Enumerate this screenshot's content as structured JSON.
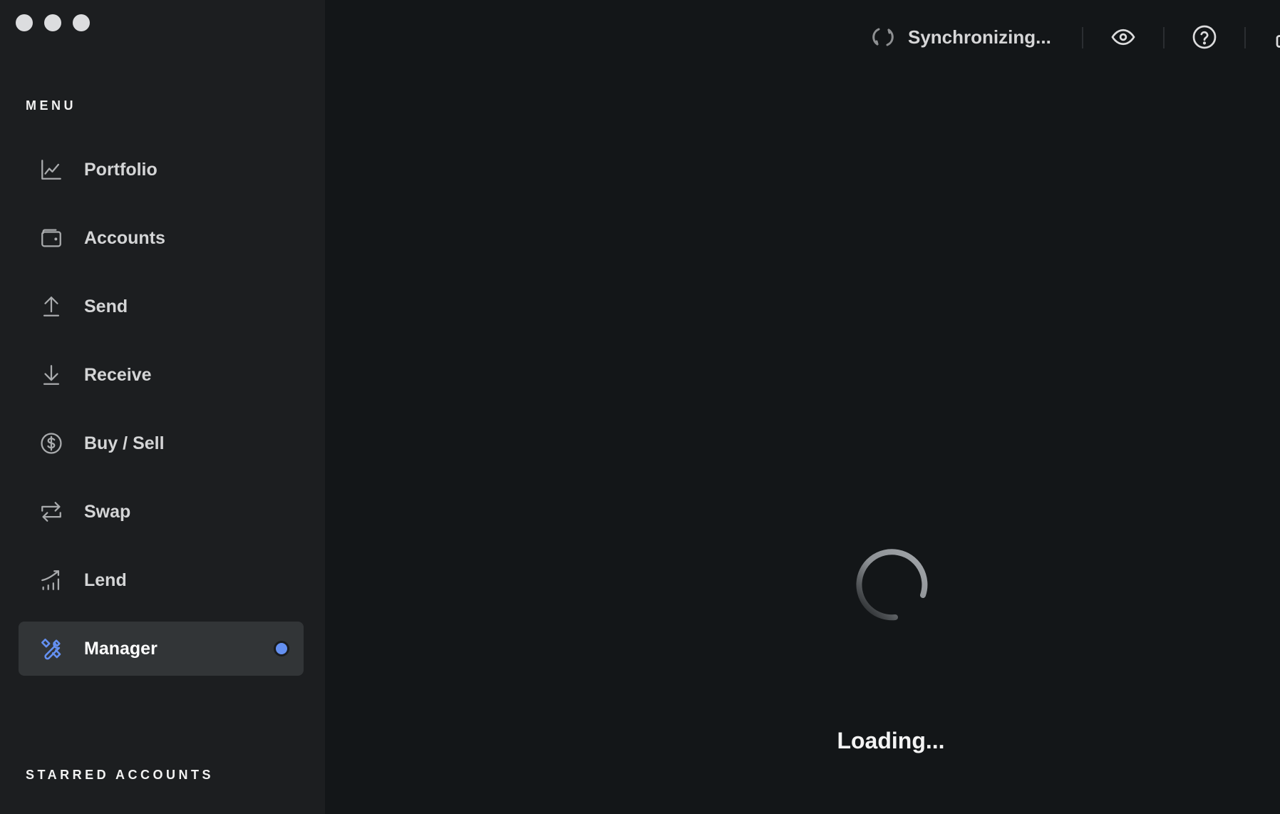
{
  "window": {
    "traffic_lights": [
      "close",
      "minimize",
      "maximize"
    ]
  },
  "sidebar": {
    "menu_title": "MENU",
    "items": [
      {
        "label": "Portfolio",
        "icon": "chart-line-icon",
        "active": false
      },
      {
        "label": "Accounts",
        "icon": "wallet-icon",
        "active": false
      },
      {
        "label": "Send",
        "icon": "arrow-up-icon",
        "active": false
      },
      {
        "label": "Receive",
        "icon": "arrow-down-icon",
        "active": false
      },
      {
        "label": "Buy / Sell",
        "icon": "dollar-circle-icon",
        "active": false
      },
      {
        "label": "Swap",
        "icon": "swap-arrows-icon",
        "active": false
      },
      {
        "label": "Lend",
        "icon": "lend-chart-icon",
        "active": false
      },
      {
        "label": "Manager",
        "icon": "tools-icon",
        "active": true,
        "notification_dot": true
      }
    ],
    "starred_title": "STARRED ACCOUNTS"
  },
  "topbar": {
    "sync_status": "Synchronizing...",
    "icons": [
      "sync-icon",
      "eye-icon",
      "help-icon",
      "lock-icon"
    ]
  },
  "main": {
    "loading_text": "Loading..."
  },
  "colors": {
    "accent": "#6490f1",
    "sidebar_bg": "#1c1e20",
    "main_bg": "#131618",
    "active_item_bg": "#323537"
  }
}
